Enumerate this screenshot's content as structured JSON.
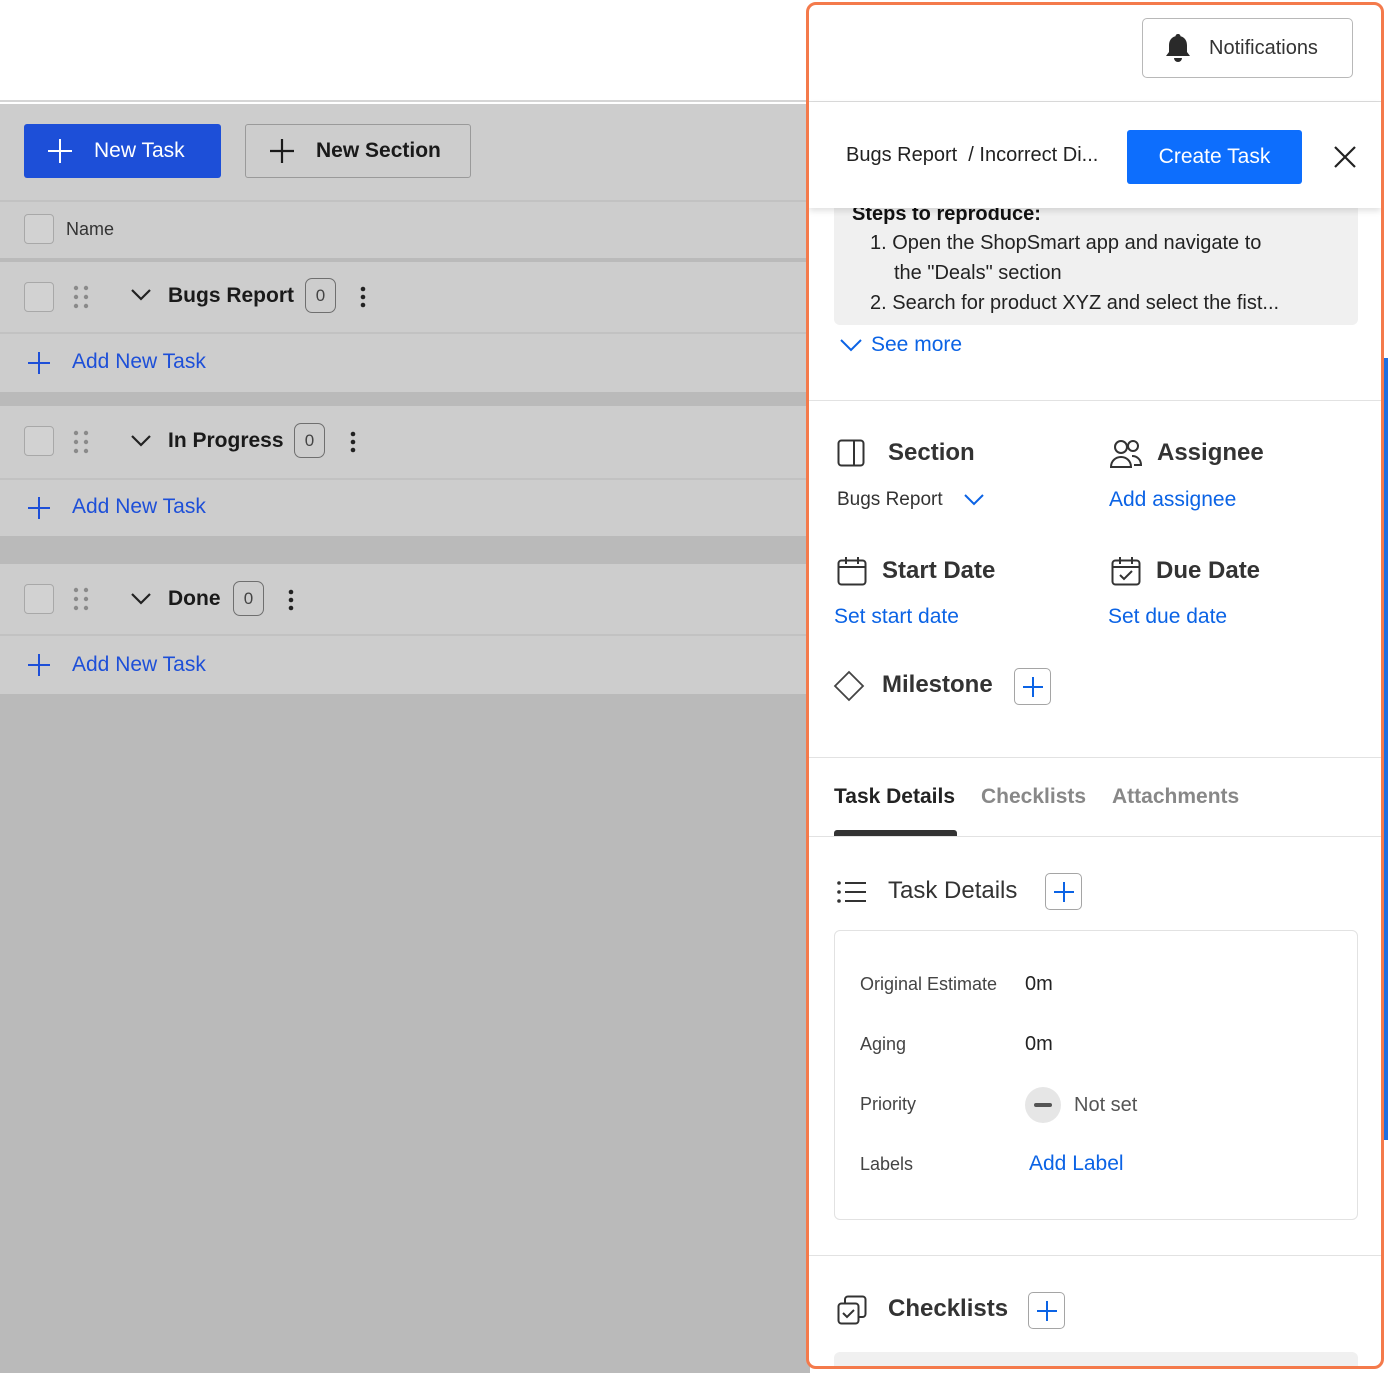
{
  "toolbar": {
    "new_task": "New Task",
    "new_section": "New Section"
  },
  "table": {
    "name_header": "Name"
  },
  "groups": [
    {
      "title": "Bugs Report",
      "count": "0",
      "add_label": "Add New Task"
    },
    {
      "title": "In Progress",
      "count": "0",
      "add_label": "Add New Task"
    },
    {
      "title": "Done",
      "count": "0",
      "add_label": "Add New Task"
    }
  ],
  "panel": {
    "notifications": "Notifications",
    "breadcrumb": "Bugs Report  / Incorrect Di...",
    "create_task": "Create Task",
    "description": {
      "heading": "Steps to reproduce:",
      "step1_line1": "1. Open the ShopSmart app and navigate to",
      "step1_line2": "the \"Deals\" section",
      "step2": "2. Search for product XYZ and select the fist...",
      "see_more": "See more"
    },
    "section": {
      "label": "Section",
      "value": "Bugs Report"
    },
    "assignee": {
      "label": "Assignee",
      "action": "Add assignee"
    },
    "start_date": {
      "label": "Start Date",
      "action": "Set start date"
    },
    "due_date": {
      "label": "Due Date",
      "action": "Set due date"
    },
    "milestone": {
      "label": "Milestone"
    },
    "tabs": [
      "Task Details",
      "Checklists",
      "Attachments"
    ],
    "active_tab": "Task Details",
    "task_details": {
      "title": "Task Details",
      "original_estimate_label": "Original Estimate",
      "original_estimate_value": "0m",
      "aging_label": "Aging",
      "aging_value": "0m",
      "priority_label": "Priority",
      "priority_value": "Not set",
      "labels_label": "Labels",
      "labels_action": "Add Label"
    },
    "checklists": {
      "title": "Checklists"
    }
  },
  "colors": {
    "primary": "#1d4fd8",
    "link": "#0b63e5",
    "panel_border": "#f47a4b",
    "create_task_bg": "#0d6efd"
  }
}
